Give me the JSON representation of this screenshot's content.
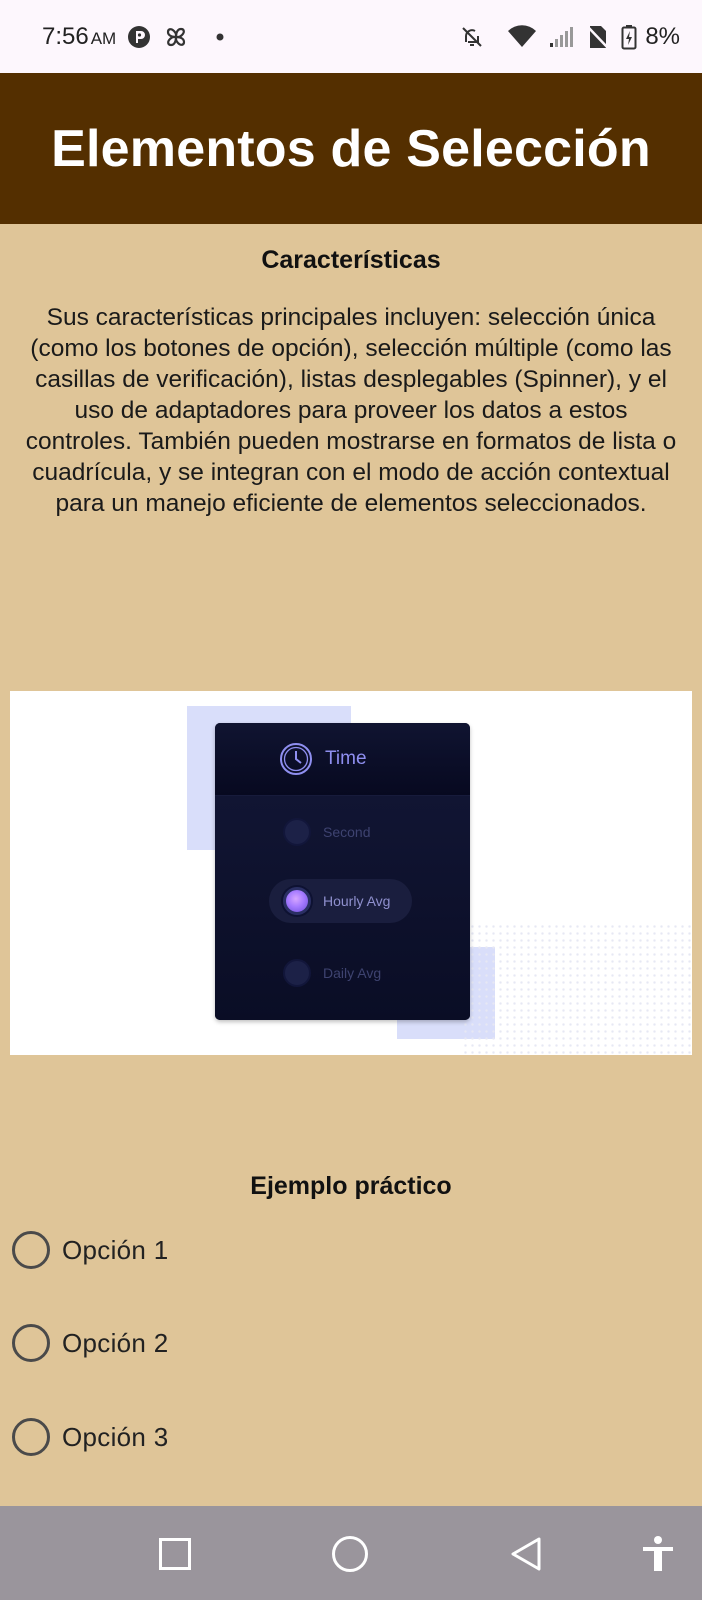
{
  "status_bar": {
    "time": "7:56",
    "ampm": "AM",
    "battery": "8%"
  },
  "app_bar": {
    "title": "Elementos de Selección"
  },
  "features": {
    "title": "Características",
    "text": "Sus características principales incluyen: selección única (como los botones de opción), selección múltiple (como las casillas de verificación), listas desplegables (Spinner), y el uso de adaptadores para proveer los datos a estos controles. También pueden mostrarse en formatos de lista o cuadrícula, y se integran con el modo de acción contextual para un manejo eficiente de elementos seleccionados."
  },
  "illustration": {
    "header_label": "Time",
    "options": [
      {
        "label": "Second",
        "selected": false
      },
      {
        "label": "Hourly Avg",
        "selected": true
      },
      {
        "label": "Daily Avg",
        "selected": false
      }
    ]
  },
  "example": {
    "title": "Ejemplo práctico",
    "options": [
      {
        "label": "Opción 1",
        "selected": false
      },
      {
        "label": "Opción 2",
        "selected": false
      },
      {
        "label": "Opción 3",
        "selected": false
      }
    ]
  },
  "colors": {
    "app_bar": "#542f00",
    "background": "#dfc598",
    "nav_bar": "#9a959c",
    "status_bar": "#fdf7fd"
  },
  "nav_bar": {
    "icons": [
      "recents-icon",
      "home-icon",
      "back-icon",
      "accessibility-icon"
    ]
  }
}
